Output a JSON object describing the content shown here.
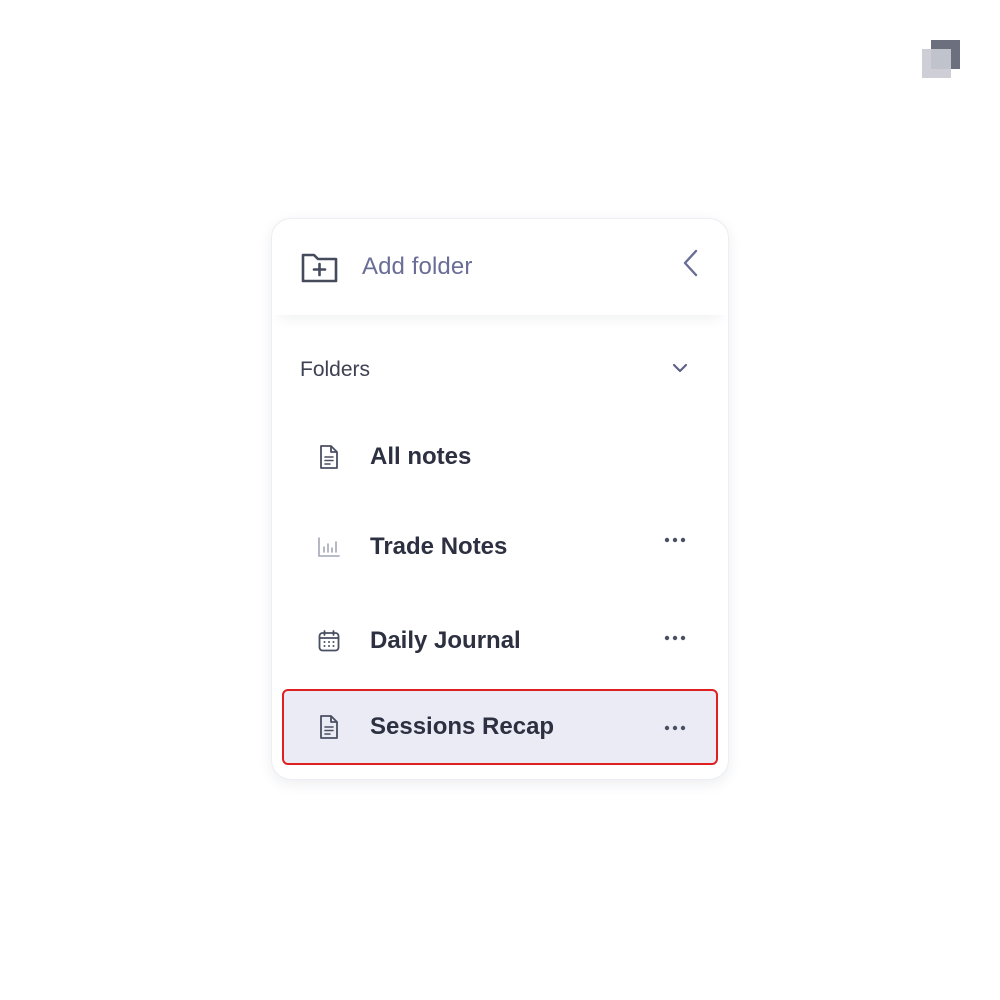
{
  "header": {
    "add_folder_label": "Add folder"
  },
  "folders_section": {
    "label": "Folders"
  },
  "folder_list": [
    {
      "label": "All notes",
      "icon": "document-icon",
      "has_menu": false
    },
    {
      "label": "Trade Notes",
      "icon": "bar-chart-icon",
      "has_menu": true
    },
    {
      "label": "Daily Journal",
      "icon": "calendar-icon",
      "has_menu": true
    },
    {
      "label": "Sessions Recap",
      "icon": "document-icon",
      "has_menu": true,
      "selected": true
    }
  ],
  "colors": {
    "accent_text": "#6a6d95",
    "item_text": "#2c3040",
    "selected_background": "#ebebf5",
    "selected_outline": "#e02020"
  }
}
